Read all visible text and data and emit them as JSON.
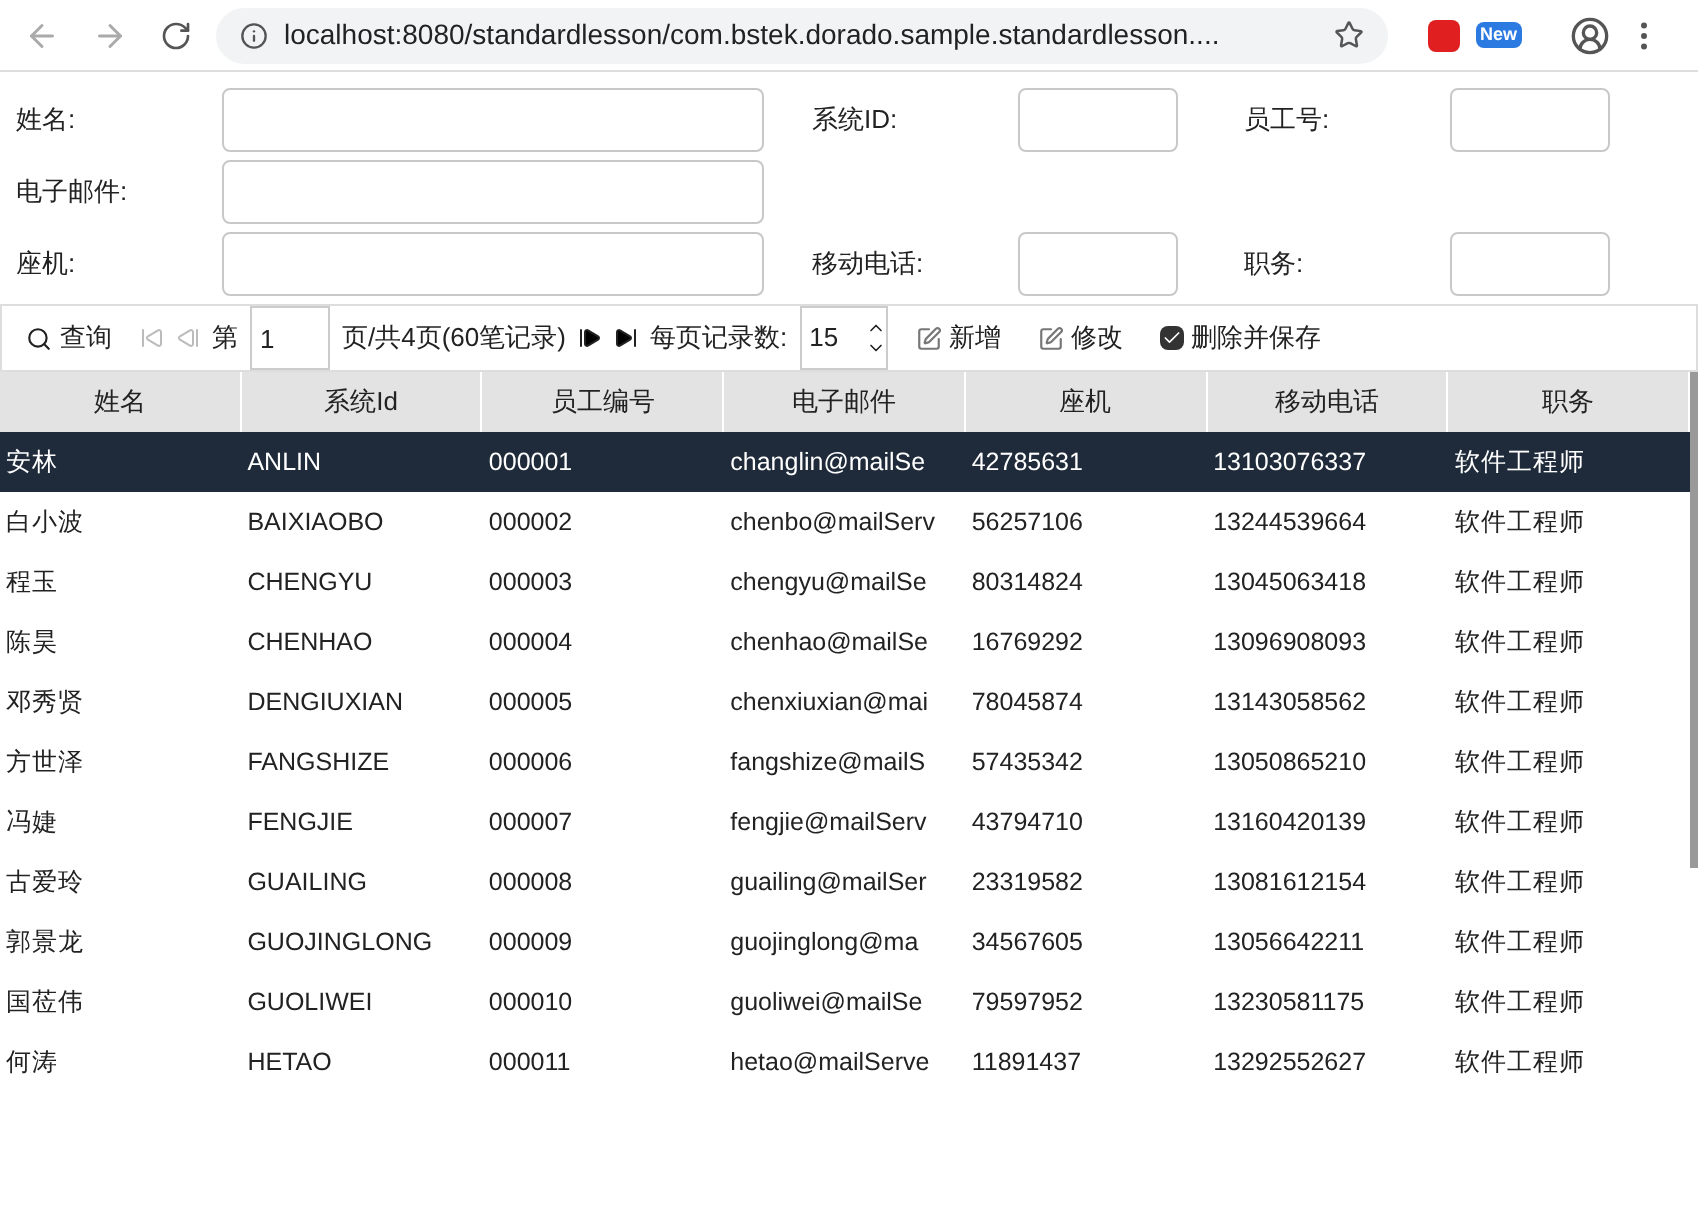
{
  "browser": {
    "url": "localhost:8080/standardlesson/com.bstek.dorado.sample.standardlesson....",
    "extension_badge": "New"
  },
  "form": [
    {
      "label": "姓名:",
      "wide": true
    },
    {
      "label": "系统ID:",
      "wide": false
    },
    {
      "label": "员工号:",
      "wide": false
    },
    {
      "label": "电子邮件:",
      "wide": true
    },
    {
      "label": "座机:",
      "wide": true
    },
    {
      "label": "移动电话:",
      "wide": false
    },
    {
      "label": "职务:",
      "wide": false
    }
  ],
  "toolbar": {
    "query": "查询",
    "page_prefix": "第",
    "page": "1",
    "page_suffix": "页/共4页(60笔记录)",
    "page_size_label": "每页记录数:",
    "page_size": "15",
    "add": "新增",
    "edit": "修改",
    "delete_save": {
      "label": "删除并保存",
      "checked": true
    }
  },
  "table": {
    "columns": [
      "姓名",
      "系统Id",
      "员工编号",
      "电子邮件",
      "座机",
      "移动电话",
      "职务"
    ],
    "rows": [
      {
        "selected": true,
        "cells": [
          "安林",
          "ANLIN",
          "000001",
          "changlin@mailSe",
          "42785631",
          "13103076337",
          "软件工程师"
        ]
      },
      {
        "selected": false,
        "cells": [
          "白小波",
          "BAIXIAOBO",
          "000002",
          "chenbo@mailServ",
          "56257106",
          "13244539664",
          "软件工程师"
        ]
      },
      {
        "selected": false,
        "cells": [
          "程玉",
          "CHENGYU",
          "000003",
          "chengyu@mailSe",
          "80314824",
          "13045063418",
          "软件工程师"
        ]
      },
      {
        "selected": false,
        "cells": [
          "陈昊",
          "CHENHAO",
          "000004",
          "chenhao@mailSe",
          "16769292",
          "13096908093",
          "软件工程师"
        ]
      },
      {
        "selected": false,
        "cells": [
          "邓秀贤",
          "DENGIUXIAN",
          "000005",
          "chenxiuxian@mai",
          "78045874",
          "13143058562",
          "软件工程师"
        ]
      },
      {
        "selected": false,
        "cells": [
          "方世泽",
          "FANGSHIZE",
          "000006",
          "fangshize@mailS",
          "57435342",
          "13050865210",
          "软件工程师"
        ]
      },
      {
        "selected": false,
        "cells": [
          "冯婕",
          "FENGJIE",
          "000007",
          "fengjie@mailServ",
          "43794710",
          "13160420139",
          "软件工程师"
        ]
      },
      {
        "selected": false,
        "cells": [
          "古爱玲",
          "GUAILING",
          "000008",
          "guailing@mailSer",
          "23319582",
          "13081612154",
          "软件工程师"
        ]
      },
      {
        "selected": false,
        "cells": [
          "郭景龙",
          "GUOJINGLONG",
          "000009",
          "guojinglong@ma",
          "34567605",
          "13056642211",
          "软件工程师"
        ]
      },
      {
        "selected": false,
        "cells": [
          "国莅伟",
          "GUOLIWEI",
          "000010",
          "guoliwei@mailSe",
          "79597952",
          "13230581175",
          "软件工程师"
        ]
      },
      {
        "selected": false,
        "cells": [
          "何涛",
          "HETAO",
          "000011",
          "hetao@mailServe",
          "11891437",
          "13292552627",
          "软件工程师"
        ]
      }
    ]
  }
}
